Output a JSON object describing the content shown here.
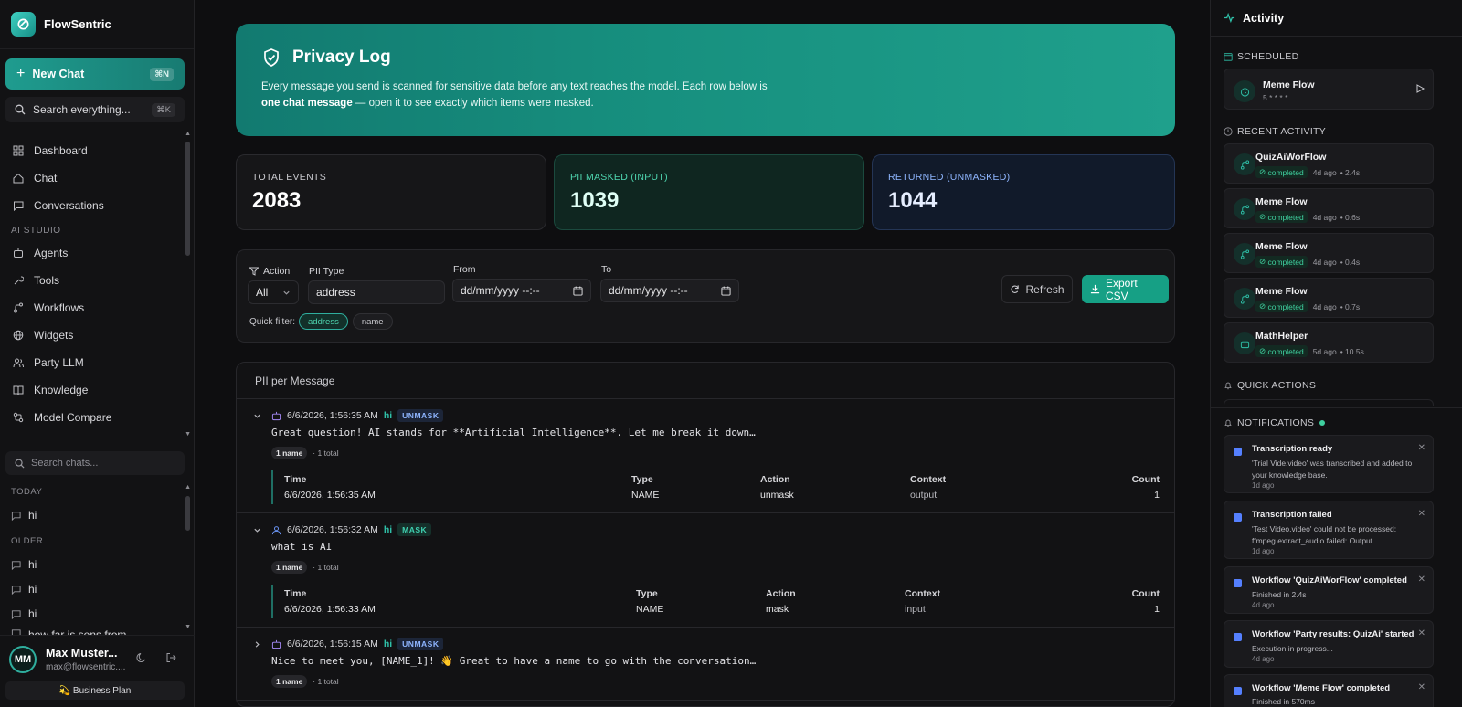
{
  "brand": {
    "name": "FlowSentric"
  },
  "sidebar": {
    "new_chat": "New Chat",
    "new_chat_kbd": "⌘N",
    "search": "Search everything...",
    "search_kbd": "⌘K",
    "items": [
      {
        "label": "Dashboard",
        "icon": "dashboard-icon"
      },
      {
        "label": "Chat",
        "icon": "home-icon"
      },
      {
        "label": "Conversations",
        "icon": "chat-bubble-icon"
      }
    ],
    "section_ai": "AI STUDIO",
    "ai_items": [
      {
        "label": "Agents",
        "icon": "bot-icon"
      },
      {
        "label": "Tools",
        "icon": "wrench-icon"
      },
      {
        "label": "Workflows",
        "icon": "workflow-icon"
      },
      {
        "label": "Widgets",
        "icon": "globe-icon"
      },
      {
        "label": "Party LLM",
        "icon": "users-icon"
      },
      {
        "label": "Knowledge",
        "icon": "book-icon"
      },
      {
        "label": "Model Compare",
        "icon": "compare-icon"
      }
    ],
    "search_chats": "Search chats...",
    "today": "TODAY",
    "older": "OLDER",
    "chats_today": [
      "hi"
    ],
    "chats_older": [
      "hi",
      "hi",
      "hi",
      "how far is sens from"
    ],
    "user": {
      "initials": "MM",
      "name": "Max Muster...",
      "email": "max@flowsentric...."
    },
    "plan": "💫 Business Plan"
  },
  "hero": {
    "title": "Privacy Log",
    "desc_1": "Every message you send is scanned for sensitive data before any text reaches the model. Each row below is",
    "desc_bold": "one chat message",
    "desc_2": " — open it to see exactly which items were masked."
  },
  "stats": [
    {
      "label": "TOTAL EVENTS",
      "value": "2083",
      "color": "#c9c9ce"
    },
    {
      "label": "PII MASKED (INPUT)",
      "value": "1039",
      "color": "#4fd6b0"
    },
    {
      "label": "RETURNED (UNMASKED)",
      "value": "1044",
      "color": "#8fb6ff"
    }
  ],
  "filters": {
    "action_label": "Action",
    "action_value": "All",
    "pii_label": "PII Type",
    "pii_value": "address",
    "from_label": "From",
    "from_value": "dd/mm/yyyy --:--",
    "to_label": "To",
    "to_value": "dd/mm/yyyy --:--",
    "refresh": "Refresh",
    "export": "Export CSV",
    "quick_label": "Quick filter:",
    "quick": [
      "address",
      "name"
    ]
  },
  "table": {
    "title": "PII per Message",
    "cols": [
      "Time",
      "Type",
      "Action",
      "Context",
      "Count"
    ],
    "messages": [
      {
        "time": "6/6/2026, 1:56:35 AM",
        "who": "hi",
        "badge": "UNMASK",
        "text": "Great question! AI stands for **Artificial Intelligence**. Let me break it down…",
        "chip": "1 name",
        "total": "· 1 total",
        "row": {
          "time": "6/6/2026, 1:56:35 AM",
          "type": "NAME",
          "action": "unmask",
          "context": "output",
          "count": "1"
        }
      },
      {
        "time": "6/6/2026, 1:56:32 AM",
        "who": "hi",
        "badge": "MASK",
        "text": "what is AI",
        "chip": "1 name",
        "total": "· 1 total",
        "row": {
          "time": "6/6/2026, 1:56:33 AM",
          "type": "NAME",
          "action": "mask",
          "context": "input",
          "count": "1"
        }
      },
      {
        "time": "6/6/2026, 1:56:15 AM",
        "who": "hi",
        "badge": "UNMASK",
        "text": "Nice to meet you, [NAME_1]! 👋 Great to have a name to go with the conversation…",
        "chip": "1 name",
        "total": "· 1 total"
      }
    ]
  },
  "activity": {
    "title": "Activity",
    "scheduled": "SCHEDULED",
    "sched_item": {
      "title": "Meme Flow",
      "sub": "5 * * * *"
    },
    "recent": "RECENT ACTIVITY",
    "recent_items": [
      {
        "title": "QuizAiWorFlow",
        "status": "completed",
        "ago": "4d ago",
        "dur": "• 2.4s"
      },
      {
        "title": "Meme Flow",
        "status": "completed",
        "ago": "4d ago",
        "dur": "• 0.6s"
      },
      {
        "title": "Meme Flow",
        "status": "completed",
        "ago": "4d ago",
        "dur": "• 0.4s"
      },
      {
        "title": "Meme Flow",
        "status": "completed",
        "ago": "4d ago",
        "dur": "• 0.7s"
      },
      {
        "title": "MathHelper",
        "status": "completed",
        "ago": "5d ago",
        "dur": "• 10.5s"
      }
    ],
    "quick_actions": "QUICK ACTIONS",
    "notifications": "NOTIFICATIONS",
    "notifs": [
      {
        "title": "Transcription ready",
        "desc": "'Trial Vide.video' was transcribed and added to your knowledge base.",
        "time": "1d ago"
      },
      {
        "title": "Transcription failed",
        "desc": "'Test Video.video' could not be processed: ffmpeg extract_audio failed: Output…",
        "time": "1d ago"
      },
      {
        "title": "Workflow 'QuizAiWorFlow' completed",
        "desc": "Finished in 2.4s",
        "time": "4d ago"
      },
      {
        "title": "Workflow 'Party results: QuizAi' started",
        "desc": "Execution in progress...",
        "time": "4d ago"
      },
      {
        "title": "Workflow 'Meme Flow' completed",
        "desc": "Finished in 570ms",
        "time": ""
      }
    ]
  }
}
